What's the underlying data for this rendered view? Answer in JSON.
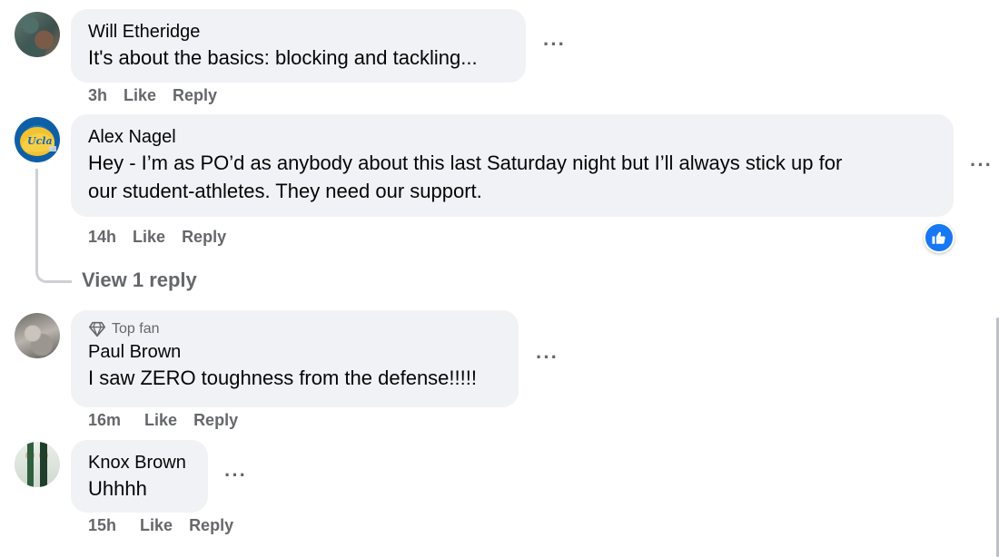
{
  "comments": [
    {
      "author": "Will Etheridge",
      "text": "It's about the basics: blocking and tackling...",
      "time": "3h",
      "like_label": "Like",
      "reply_label": "Reply"
    },
    {
      "author": "Alex Nagel",
      "text_line1": "Hey - I’m as PO’d as anybody about this last Saturday night but I’ll always stick up for",
      "text_line2": "our student-athletes. They need our support.",
      "time": "14h",
      "like_label": "Like",
      "reply_label": "Reply",
      "reaction": "like",
      "view_replies_label": "View 1 reply",
      "avatar_logo": "Ucla"
    },
    {
      "badge": "Top fan",
      "author": "Paul Brown",
      "text": "I saw ZERO toughness from the defense!!!!!",
      "time": "16m",
      "like_label": "Like",
      "reply_label": "Reply"
    },
    {
      "author": "Knox Brown",
      "text": "Uhhhh",
      "time": "15h",
      "like_label": "Like",
      "reply_label": "Reply"
    }
  ],
  "more_options": "···",
  "colors": {
    "bubble": "#f0f2f5",
    "meta_text": "#65676b",
    "reaction_blue": "#1877f2",
    "thread_line": "#ced0d4"
  }
}
